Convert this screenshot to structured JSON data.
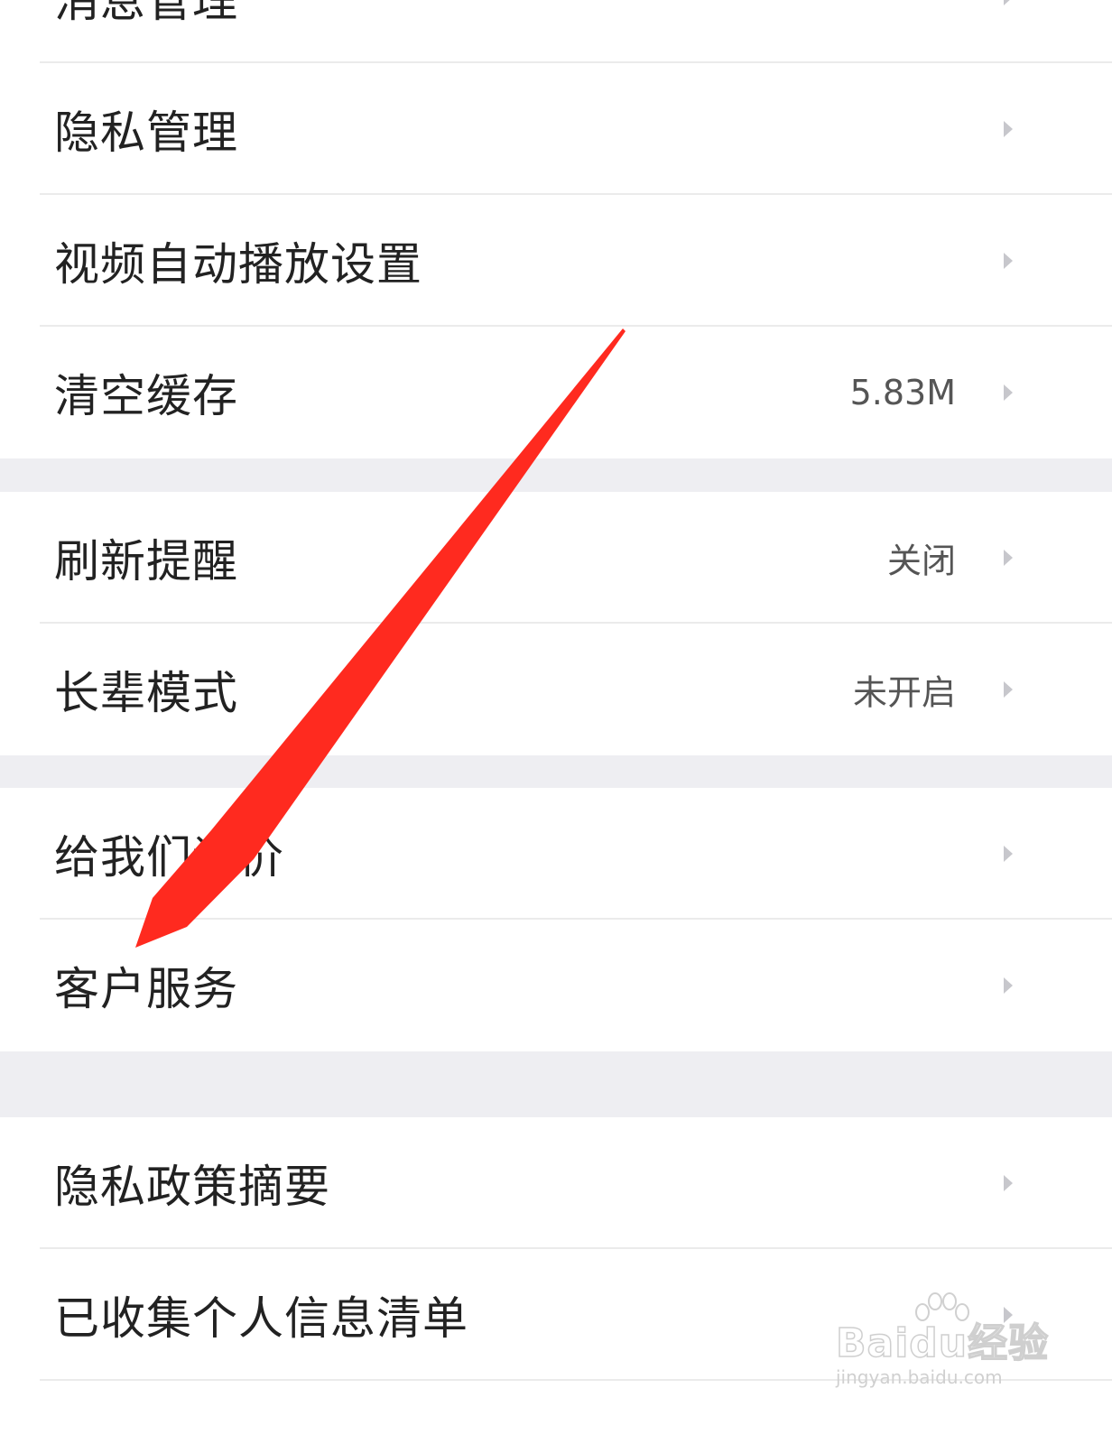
{
  "settings": {
    "rows": [
      {
        "label": "消息管理",
        "value": ""
      },
      {
        "label": "隐私管理",
        "value": ""
      },
      {
        "label": "视频自动播放设置",
        "value": ""
      },
      {
        "label": "清空缓存",
        "value": "5.83M"
      },
      {
        "label": "刷新提醒",
        "value": "关闭"
      },
      {
        "label": "长辈模式",
        "value": "未开启"
      },
      {
        "label": "给我们评价",
        "value": ""
      },
      {
        "label": "客户服务",
        "value": ""
      },
      {
        "label": "隐私政策摘要",
        "value": ""
      },
      {
        "label": "已收集个人信息清单",
        "value": ""
      }
    ]
  },
  "annotation": {
    "arrow_color": "#ff2a1f",
    "points_to": "客户服务"
  },
  "watermark": {
    "brand": "Baidu经验",
    "url": "jingyan.baidu.com"
  },
  "colors": {
    "section_gap": "#eeeef2",
    "divider": "#ebebeb",
    "chevron": "#c7c7cc",
    "label_text": "#222222",
    "value_text": "#555555"
  },
  "icons": {
    "row_chevron": "chevron-right-icon"
  }
}
